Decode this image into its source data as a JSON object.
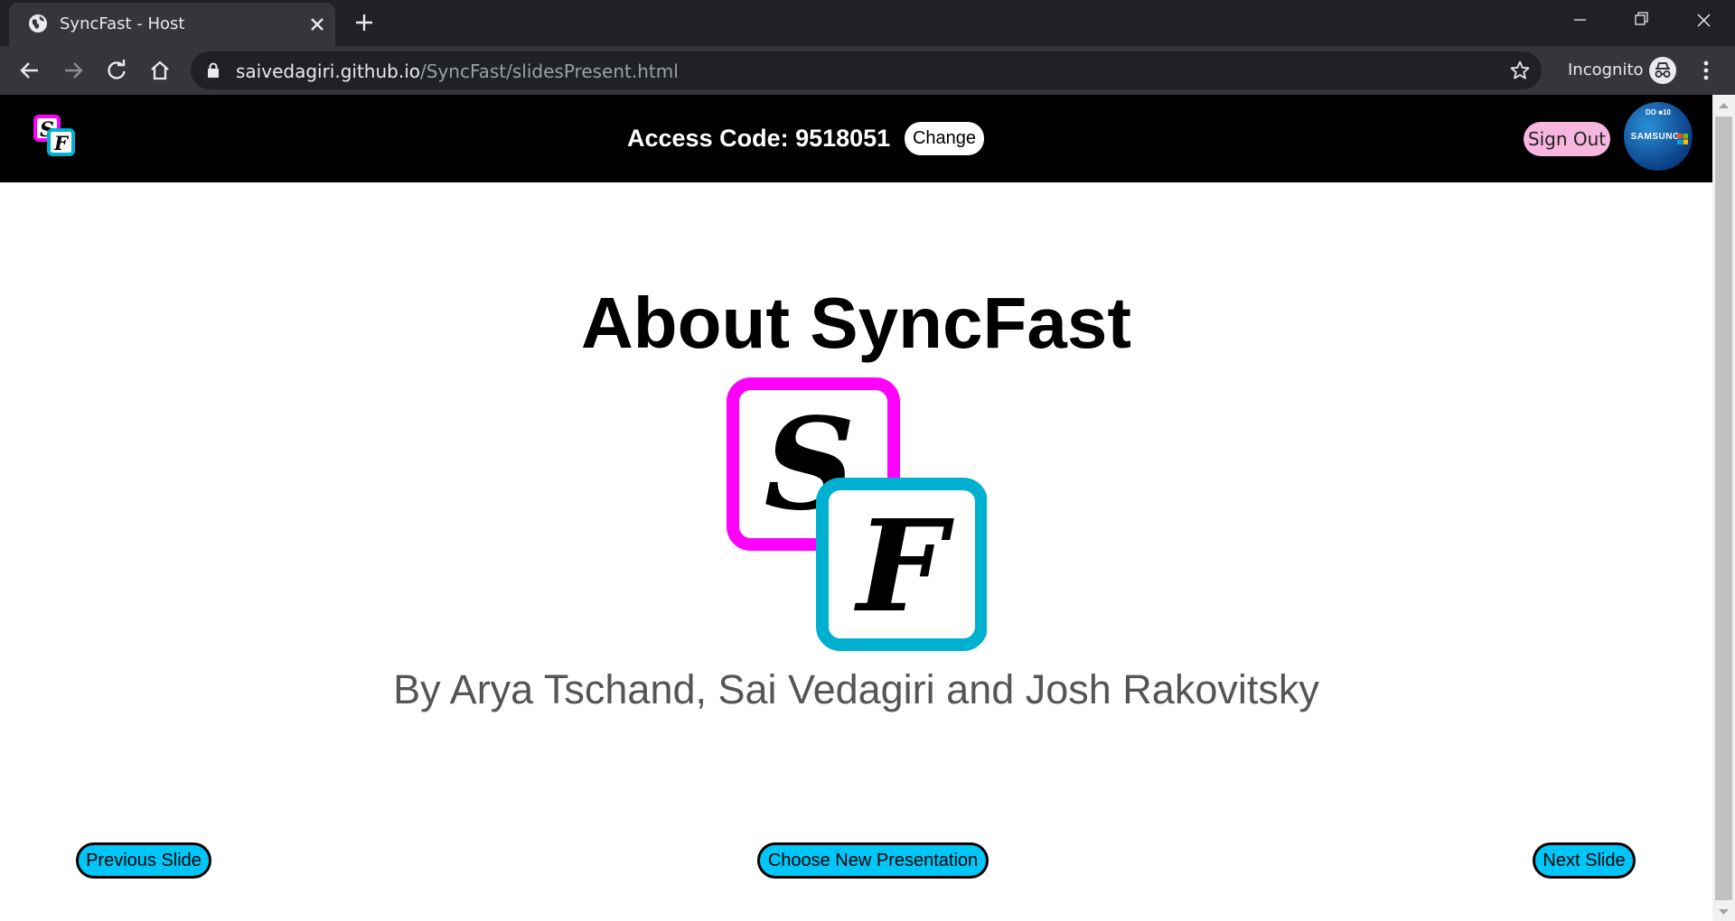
{
  "browser": {
    "tab_title": "SyncFast - Host",
    "url_host": "saivedagiri.github.io",
    "url_path": "/SyncFast/slidesPresent.html",
    "profile_label": "Incognito"
  },
  "header": {
    "access_code_text": "Access Code: 9518051",
    "change_label": "Change",
    "sign_out_label": "Sign Out",
    "avatar_badge": "DO ■10",
    "avatar_brand": "SAMSUNG"
  },
  "slide": {
    "title": "About SyncFast",
    "logo_letters": [
      "S",
      "F"
    ],
    "subtitle": "By Arya Tschand, Sai Vedagiri and Josh Rakovitsky"
  },
  "controls": {
    "previous_label": "Previous Slide",
    "choose_label": "Choose New Presentation",
    "next_label": "Next Slide"
  },
  "colors": {
    "header_bg": "#000000",
    "logo_magenta": "#ff00ff",
    "logo_cyan": "#00b0d0",
    "slide_button": "#00c6f8",
    "sign_out_pink": "#f7b6e0"
  }
}
